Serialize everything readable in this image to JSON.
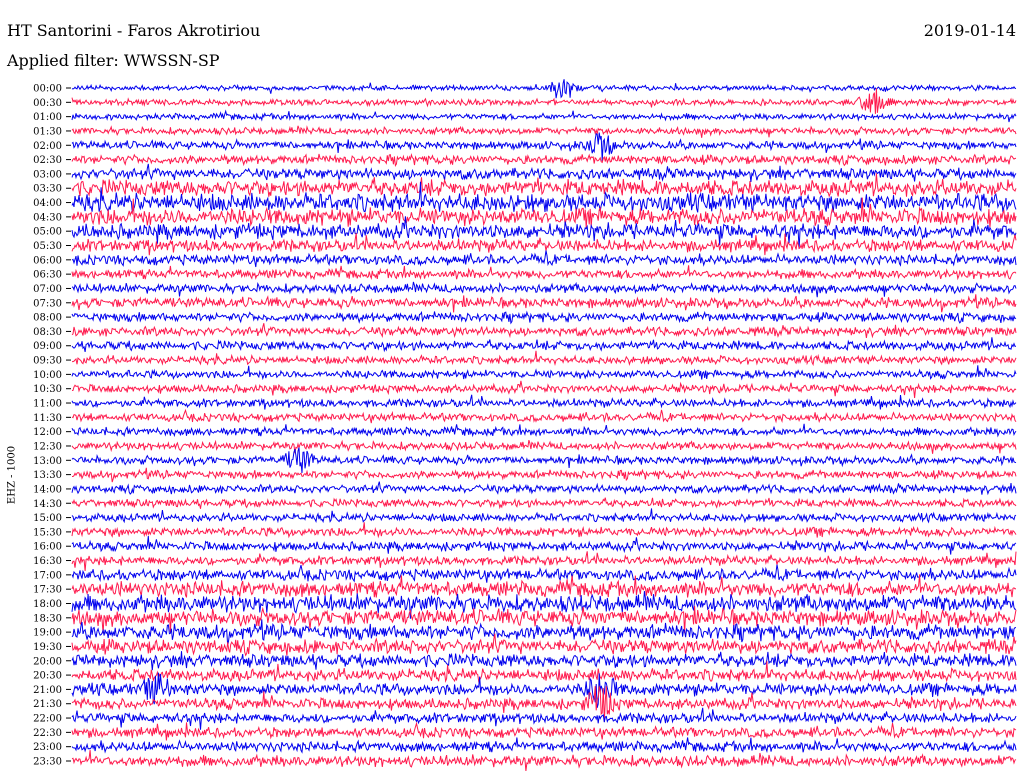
{
  "header": {
    "station": "HT Santorini - Faros Akrotiriou",
    "date": "2019-01-14",
    "filter": "Applied filter: WWSSN-SP"
  },
  "channel_label": "EHZ - 1000",
  "colors": {
    "trace_a": "#0000ee",
    "trace_b": "#ff1a4d",
    "background": "#ffffff"
  },
  "chart_data": {
    "type": "line",
    "title": "HT Santorini - Faros Akrotiriou",
    "subtitle": "Applied filter: WWSSN-SP",
    "ylabel": "EHZ - 1000",
    "row_interval_minutes": 30,
    "rows": [
      "00:00",
      "00:30",
      "01:00",
      "01:30",
      "02:00",
      "02:30",
      "03:00",
      "03:30",
      "04:00",
      "04:30",
      "05:00",
      "05:30",
      "06:00",
      "06:30",
      "07:00",
      "07:30",
      "08:00",
      "08:30",
      "09:00",
      "09:30",
      "10:00",
      "10:30",
      "11:00",
      "11:30",
      "12:00",
      "12:30",
      "13:00",
      "13:30",
      "14:00",
      "14:30",
      "15:00",
      "15:30",
      "16:00",
      "16:30",
      "17:00",
      "17:30",
      "18:00",
      "18:30",
      "19:00",
      "19:30",
      "20:00",
      "20:30",
      "21:00",
      "21:30",
      "22:00",
      "22:30",
      "23:00",
      "23:30"
    ],
    "series_colors": [
      "#0000ee",
      "#ff1a4d"
    ],
    "relative_noise_amplitude": [
      0.25,
      0.3,
      0.3,
      0.35,
      0.4,
      0.45,
      0.55,
      0.8,
      0.9,
      0.85,
      0.75,
      0.6,
      0.5,
      0.45,
      0.45,
      0.5,
      0.45,
      0.45,
      0.45,
      0.4,
      0.4,
      0.4,
      0.4,
      0.4,
      0.4,
      0.4,
      0.4,
      0.4,
      0.4,
      0.4,
      0.4,
      0.45,
      0.45,
      0.45,
      0.55,
      0.75,
      0.85,
      0.8,
      0.75,
      0.7,
      0.65,
      0.6,
      0.6,
      0.55,
      0.5,
      0.5,
      0.5,
      0.55
    ],
    "events": [
      {
        "row": 0,
        "t": 0.52,
        "amp": 1.4
      },
      {
        "row": 1,
        "t": 0.85,
        "amp": 1.5
      },
      {
        "row": 4,
        "t": 0.56,
        "amp": 1.5
      },
      {
        "row": 26,
        "t": 0.24,
        "amp": 1.4
      },
      {
        "row": 42,
        "t": 0.09,
        "amp": 1.6
      },
      {
        "row": 42,
        "t": 0.56,
        "amp": 1.9
      },
      {
        "row": 43,
        "t": 0.56,
        "amp": 2.0
      }
    ]
  }
}
